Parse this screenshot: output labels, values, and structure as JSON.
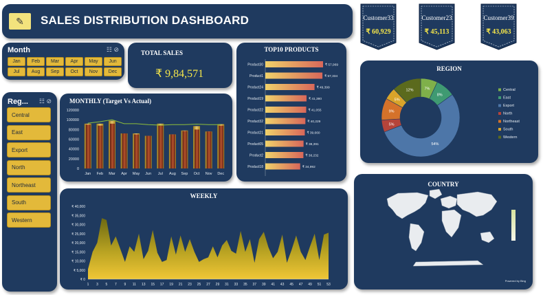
{
  "title": "SALES DISTRIBUTION DASHBOARD",
  "month_slicer": {
    "title": "Month",
    "months": [
      "Jan",
      "Feb",
      "Mar",
      "Apr",
      "May",
      "Jun",
      "Jul",
      "Aug",
      "Sep",
      "Oct",
      "Nov",
      "Dec"
    ]
  },
  "region_slicer": {
    "title": "Reg...",
    "items": [
      "Central",
      "East",
      "Export",
      "North",
      "Northeast",
      "South",
      "Western"
    ]
  },
  "total_sales": {
    "label": "TOTAL SALES",
    "value": "₹ 9,84,571"
  },
  "customers": [
    {
      "name": "Customer33",
      "value": "₹ 60,929"
    },
    {
      "name": "Customer23",
      "value": "₹ 45,113"
    },
    {
      "name": "Customer39",
      "value": "₹ 43,063"
    }
  ],
  "colors": {
    "panel": "#1f3a5f",
    "gold": "#e3b93a",
    "bar_actual": "#8a2f1a",
    "bar_target": "#d4a52a",
    "value_yellow": "#f5e64a"
  },
  "chart_data": [
    {
      "type": "bar",
      "title": "MONTHLY (Target Vs Actual)",
      "categories": [
        "Jan",
        "Feb",
        "Mar",
        "Apr",
        "May",
        "Jun",
        "Jul",
        "Aug",
        "Sep",
        "Oct",
        "Nov",
        "Dec"
      ],
      "yticks": [
        "0",
        "20000",
        "40000",
        "60000",
        "80000",
        "100000",
        "120000"
      ],
      "ylim": [
        0,
        120000
      ],
      "series": [
        {
          "values": [
            92000,
            92000,
            98000,
            72000,
            72000,
            67000,
            92000,
            70000,
            78000,
            87000,
            76000,
            91000
          ]
        },
        {
          "values": [
            90000,
            88000,
            92000,
            72000,
            70000,
            67000,
            88000,
            70000,
            77000,
            80000,
            76000,
            88000
          ]
        }
      ],
      "line": [
        93000,
        96000,
        100000,
        92000,
        92000,
        90000,
        89000,
        90000,
        90000,
        91000,
        90000,
        90000
      ]
    },
    {
      "type": "bar",
      "title": "TOP10 PRODUCTS",
      "categories": [
        "Product30",
        "Product1",
        "Product24",
        "Product19",
        "Product22",
        "Product32",
        "Product21",
        "Product05",
        "Product2",
        "Product18"
      ],
      "values": [
        57969,
        57334,
        49399,
        41380,
        41055,
        40229,
        39660,
        38391,
        38232,
        34992
      ],
      "labels": [
        "₹ 57,969",
        "₹ 57,334",
        "₹ 49,399",
        "₹ 41,380",
        "₹ 41,055",
        "₹ 40,229",
        "₹ 39,660",
        "₹ 38,391",
        "₹ 38,232",
        "₹ 34,992"
      ]
    },
    {
      "type": "pie",
      "title": "REGION",
      "categories": [
        "Central",
        "East",
        "Export",
        "North",
        "Northeast",
        "South",
        "Western"
      ],
      "values": [
        7,
        8,
        54,
        5,
        9,
        5,
        12
      ],
      "labels": [
        "7%",
        "8%",
        "54%",
        "5%",
        "9%",
        "5%",
        "12%"
      ],
      "colors": [
        "#7fb04a",
        "#3f9a72",
        "#4d76a8",
        "#b5443a",
        "#d5722a",
        "#d9a42a",
        "#5b6a1d"
      ]
    },
    {
      "type": "area",
      "title": "WEEKLY",
      "x": [
        1,
        2,
        3,
        4,
        5,
        6,
        7,
        8,
        9,
        10,
        11,
        12,
        13,
        14,
        15,
        16,
        17,
        18,
        19,
        20,
        21,
        22,
        23,
        24,
        25,
        26,
        27,
        28,
        29,
        30,
        31,
        32,
        33,
        34,
        35,
        36,
        37,
        38,
        39,
        40,
        41,
        42,
        43,
        44,
        45,
        46,
        47,
        48,
        49,
        50,
        51,
        52,
        53
      ],
      "xticks": [
        "1",
        "3",
        "5",
        "7",
        "9",
        "11",
        "13",
        "15",
        "17",
        "19",
        "21",
        "23",
        "25",
        "27",
        "29",
        "31",
        "33",
        "35",
        "37",
        "39",
        "41",
        "43",
        "45",
        "47",
        "49",
        "51",
        "53"
      ],
      "yticks": [
        "₹ 0",
        "₹ 5,000",
        "₹ 10,000",
        "₹ 15,000",
        "₹ 20,000",
        "₹ 25,000",
        "₹ 30,000",
        "₹ 35,000",
        "₹ 40,000"
      ],
      "ylim": [
        0,
        40000
      ],
      "values": [
        5500,
        15000,
        20000,
        33500,
        32500,
        18500,
        23500,
        16500,
        9500,
        18000,
        15000,
        25000,
        11000,
        15500,
        27000,
        14500,
        9500,
        10500,
        23500,
        13500,
        24000,
        15000,
        22000,
        15000,
        9500,
        11000,
        12000,
        18000,
        12000,
        18500,
        21500,
        15500,
        14000,
        26500,
        15000,
        22000,
        9000,
        22000,
        26000,
        17500,
        11500,
        15000,
        24500,
        9000,
        16000,
        24000,
        15000,
        10500,
        18000,
        25000,
        10500,
        24500,
        25500
      ]
    }
  ],
  "country": {
    "title": "COUNTRY",
    "credit": "Powered by Bing"
  }
}
